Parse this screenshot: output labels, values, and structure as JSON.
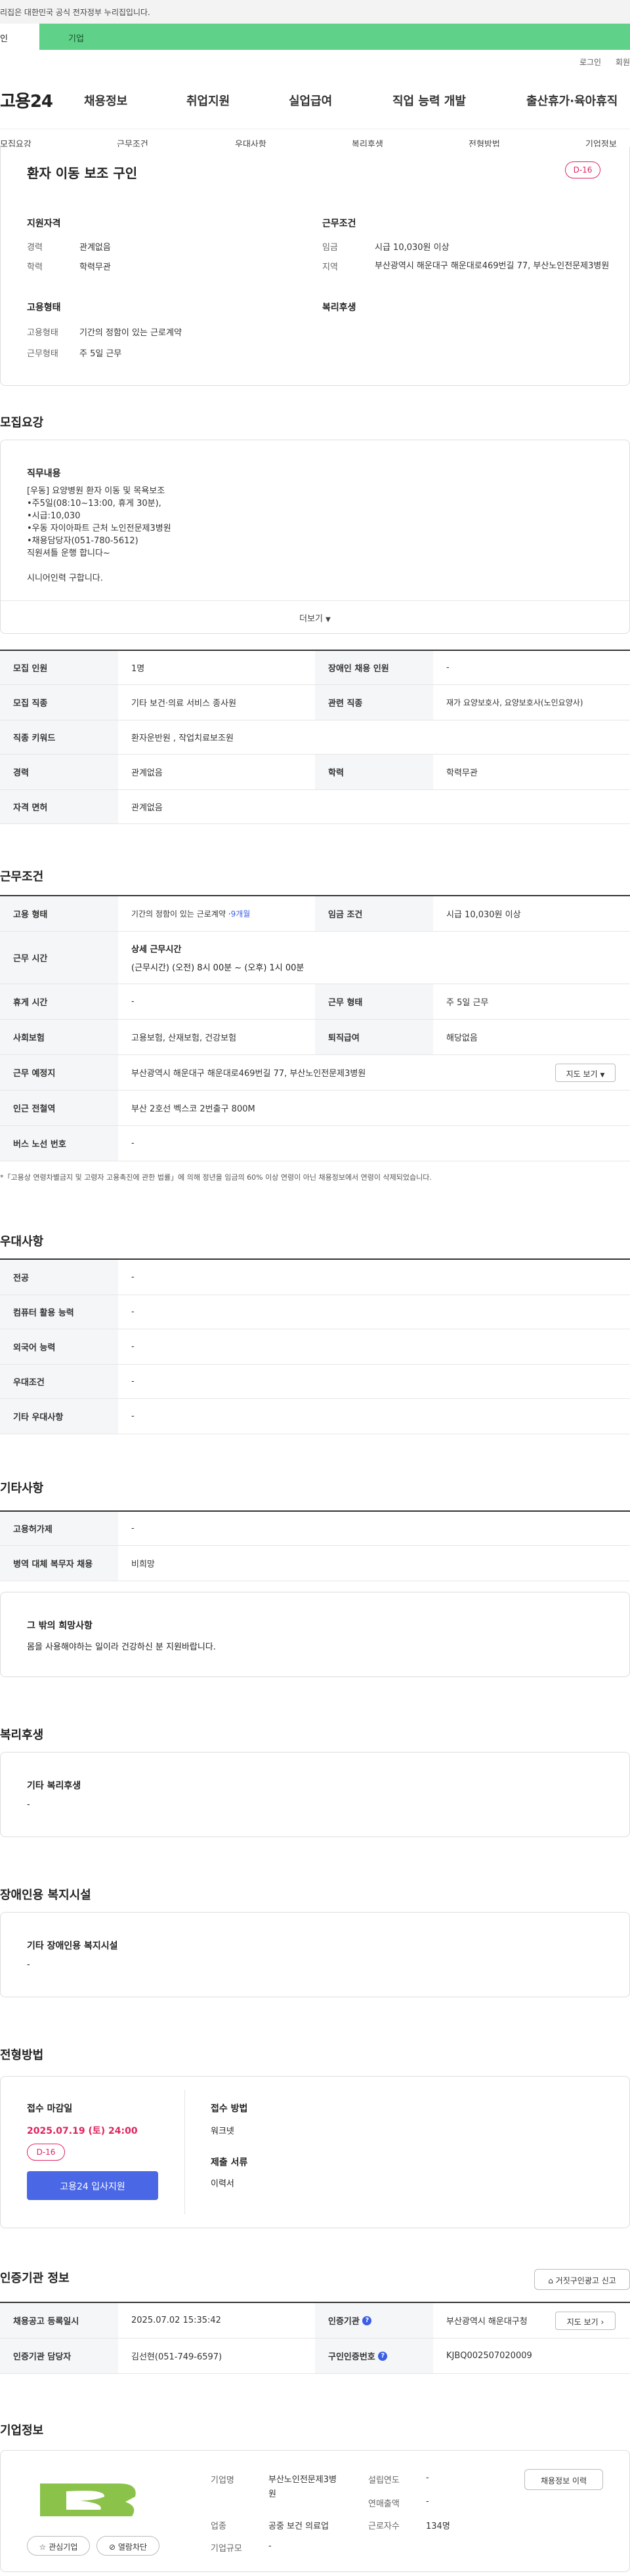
{
  "notice": "리집은 대한민국 공식 전자정부 누리집입니다.",
  "tabs": {
    "person": "인",
    "company": "기업"
  },
  "util": {
    "login": "로그인",
    "join": "회원"
  },
  "gnb": {
    "logo": "고용24",
    "m1": "채용정보",
    "m2": "취업지원",
    "m3": "실업급여",
    "m4": "직업 능력 개발",
    "m5": "출산휴가·육아휴직"
  },
  "subnav": [
    "모집요강",
    "근무조건",
    "우대사항",
    "복리후생",
    "전형방법",
    "기업정보"
  ],
  "job": {
    "title": "환자 이동 보조 구인",
    "dday": "D-16",
    "qual_head": "지원자격",
    "career_lbl": "경력",
    "career_val": "관계없음",
    "edu_lbl": "학력",
    "edu_val": "학력무관",
    "emp_head": "고용형태",
    "emptype_lbl": "고용형태",
    "emptype_val": "기간의 정함이 있는 근로계약",
    "workform_lbl": "근무형태",
    "workform_val": "주 5일 근무",
    "cond_head": "근무조건",
    "wage_lbl": "임금",
    "wage_val": "시급 10,030원 이상",
    "region_lbl": "지역",
    "region_val": "부산광역시 해운대구 해운대로469번길 77, 부산노인전문제3병원",
    "welfare_head": "복리후생"
  },
  "recruit": {
    "section": "모집요강",
    "duty_head": "직무내용",
    "duty_lines": [
      "[우동] 요양병원 환자 이동 및 목욕보조",
      "•주5일(08:10~13:00, 휴게 30분),",
      "•시급:10,030",
      "•우동 자이아파트 근처 노인전문제3병원",
      "•채용담당자(051-780-5612)",
      "직원셔틀 운행 합니다~",
      "",
      "시니어인력 구합니다."
    ],
    "more": "더보기"
  },
  "recruit_table": [
    {
      "h1": "모집 인원",
      "v1": "1명",
      "h2": "장애인 채용 인원",
      "v2": "-"
    },
    {
      "h1": "모집 직종",
      "v1": "기타 보건·의료 서비스 종사원",
      "h2": "관련 직종",
      "v2": "재가 요양보호사, 요양보호사(노인요양사)"
    },
    {
      "h1": "직종 키워드",
      "v1": "환자운반원 , 작업치료보조원",
      "h2": "",
      "v2": ""
    },
    {
      "h1": "경력",
      "v1": "관계없음",
      "h2": "학력",
      "v2": "학력무관"
    },
    {
      "h1": "자격 면허",
      "v1": "관계없음",
      "h2": "",
      "v2": ""
    }
  ],
  "work": {
    "section": "근무조건",
    "emp_h": "고용 형태",
    "emp_v": "기간의 정함이 있는 근로계약 · ",
    "emp_months": "9개월",
    "wage_h": "임금 조건",
    "wage_v": "시급 10,030원 이상",
    "time_h": "근무 시간",
    "time_title": "상세 근무시간",
    "time_v": "(근무시간) (오전) 8시 00분 ~ (오후) 1시 00분",
    "rest_h": "휴게 시간",
    "rest_v": "-",
    "form_h": "근무 형태",
    "form_v": "주 5일 근무",
    "ins_h": "사회보험",
    "ins_v": "고용보험, 산재보험, 건강보험",
    "sev_h": "퇴직급여",
    "sev_v": "해당없음",
    "place_h": "근무 예정지",
    "place_v": "부산광역시 해운대구 해운대로469번길 77, 부산노인전문제3병원",
    "map_btn": "지도 보기",
    "subway_h": "인근 전철역",
    "subway_v": "부산 2호선 벡스코 2번출구 800M",
    "bus_h": "버스 노선 번호",
    "bus_v": "-",
    "note": "*「고용상 연령차별금지 및 고령자 고용촉진에 관한 법률」에 의해 정년을 임금의 60% 이상 연령이 아닌 채용정보에서 연령이 삭제되었습니다."
  },
  "pref": {
    "section": "우대사항",
    "rows": [
      {
        "h": "전공",
        "v": "-"
      },
      {
        "h": "컴퓨터 활용 능력",
        "v": "-"
      },
      {
        "h": "외국어 능력",
        "v": "-"
      },
      {
        "h": "우대조건",
        "v": "-"
      },
      {
        "h": "기타 우대사항",
        "v": "-"
      }
    ]
  },
  "etc": {
    "section": "기타사항",
    "rows": [
      {
        "h": "고용허가제",
        "v": "-"
      },
      {
        "h": "병역 대체 복무자 채용",
        "v": "비희망"
      }
    ],
    "hope_head": "그 밖의 희망사항",
    "hope_val": "몸을 사용해야하는 일이라 건강하신 분 지원바랍니다."
  },
  "welfare": {
    "section": "복리후생",
    "head": "기타 복리후생",
    "val": "-"
  },
  "disabled": {
    "section": "장애인용 복지시설",
    "head": "기타 장애인용 복지시설",
    "val": "-"
  },
  "apply": {
    "section": "전형방법",
    "deadline_head": "접수 마감일",
    "deadline_val": "2025.07.19 (토) 24:00",
    "dday": "D-16",
    "apply_btn": "고용24 입사지원",
    "method_head": "접수 방법",
    "method_val": "워크넷",
    "docs_head": "제출 서류",
    "docs_val": "이력서"
  },
  "cert": {
    "section": "인증기관 정보",
    "report_btn": "거짓구인광고 신고",
    "reg_h": "채용공고 등록일시",
    "reg_v": "2025.07.02 15:35:42",
    "org_h": "인증기관",
    "org_v": "부산광역시 해운대구청",
    "map_btn": "지도 보기",
    "mgr_h": "인증기관 담당자",
    "mgr_v": "김선현(051-749-6597)",
    "no_h": "구인인증번호",
    "no_v": "KJBQ002507020009"
  },
  "company": {
    "section": "기업정보",
    "history_btn": "채용정보 이력",
    "fav_btn": "관심기업",
    "block_btn": "열람차단",
    "name_l": "기업명",
    "name_v": "부산노인전문제3병원",
    "year_l": "설립연도",
    "year_v": "-",
    "sales_l": "연매출액",
    "sales_v": "-",
    "ind_l": "업종",
    "ind_v": "공중 보건 의료업",
    "emp_l": "근로자수",
    "emp_v": "134명",
    "size_l": "기업규모",
    "size_v": "-"
  }
}
